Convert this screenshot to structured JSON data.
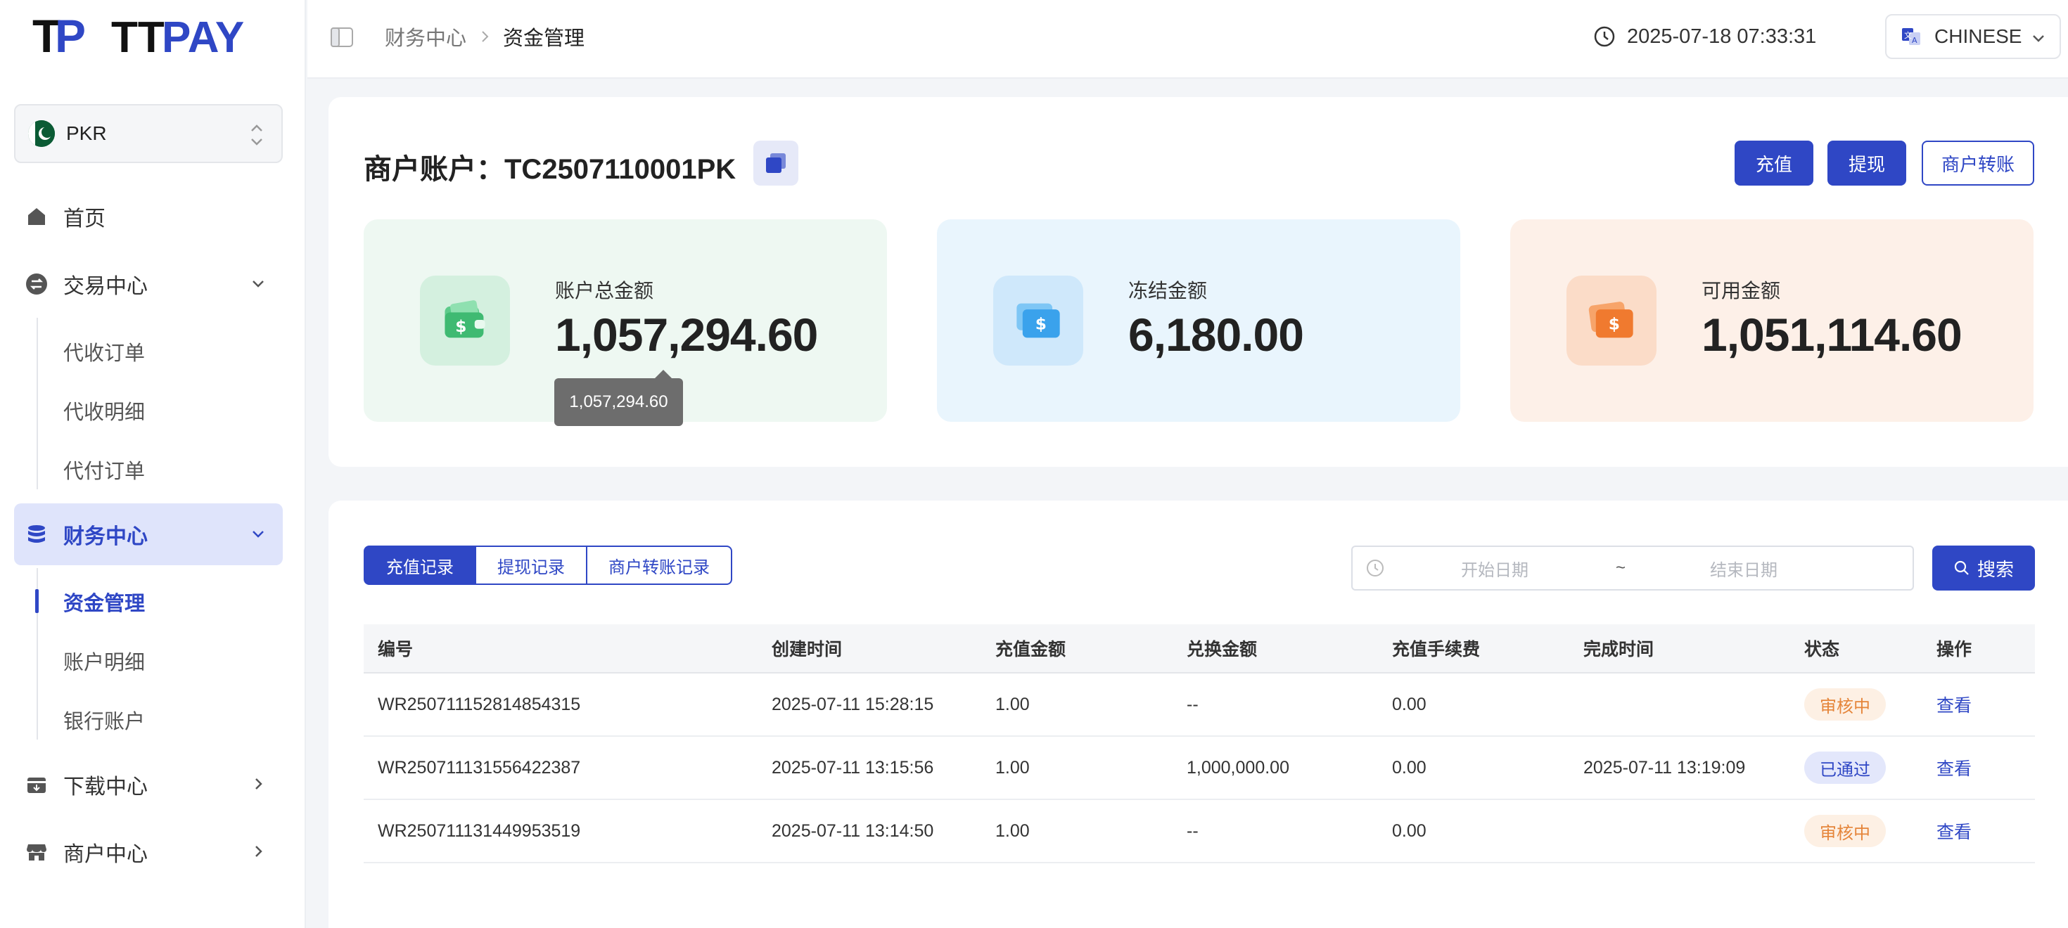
{
  "brand": {
    "logo_text": "TTPAY"
  },
  "currency": {
    "code": "PKR"
  },
  "sidebar": {
    "home": "首页",
    "trade": {
      "label": "交易中心",
      "items": [
        "代收订单",
        "代收明细",
        "代付订单"
      ]
    },
    "finance": {
      "label": "财务中心",
      "items": [
        "资金管理",
        "账户明细",
        "银行账户"
      ]
    },
    "download": "下载中心",
    "merchant": "商户中心"
  },
  "header": {
    "breadcrumb": [
      "财务中心",
      "资金管理"
    ],
    "datetime": "2025-07-18 07:33:31",
    "language": "CHINESE"
  },
  "account": {
    "title": "商户账户：TC2507110001PK",
    "actions": {
      "recharge": "充值",
      "withdraw": "提现",
      "transfer": "商户转账"
    },
    "stats": [
      {
        "label": "账户总金额",
        "value": "1,057,294.60"
      },
      {
        "label": "冻结金额",
        "value": "6,180.00"
      },
      {
        "label": "可用金额",
        "value": "1,051,114.60"
      }
    ],
    "tooltip": "1,057,294.60"
  },
  "records": {
    "tabs": [
      "充值记录",
      "提现记录",
      "商户转账记录"
    ],
    "date_start_placeholder": "开始日期",
    "date_separator": "~",
    "date_end_placeholder": "结束日期",
    "search_label": "搜索",
    "columns": [
      "编号",
      "创建时间",
      "充值金额",
      "兑换金额",
      "充值手续费",
      "完成时间",
      "状态",
      "操作"
    ],
    "rows": [
      {
        "id": "WR250711152814854315",
        "created": "2025-07-11 15:28:15",
        "amount": "1.00",
        "exchange": "--",
        "fee": "0.00",
        "completed": "",
        "status": "审核中",
        "action": "查看"
      },
      {
        "id": "WR250711131556422387",
        "created": "2025-07-11 13:15:56",
        "amount": "1.00",
        "exchange": "1,000,000.00",
        "fee": "0.00",
        "completed": "2025-07-11 13:19:09",
        "status": "已通过",
        "action": "查看"
      },
      {
        "id": "WR250711131449953519",
        "created": "2025-07-11 13:14:50",
        "amount": "1.00",
        "exchange": "--",
        "fee": "0.00",
        "completed": "",
        "status": "审核中",
        "action": "查看"
      }
    ]
  },
  "colors": {
    "primary": "#2f47c5",
    "pending": "#e5853a",
    "green_card": "#eef8f2",
    "blue_card": "#e9f5fd",
    "orange_card": "#fdf0e8"
  }
}
